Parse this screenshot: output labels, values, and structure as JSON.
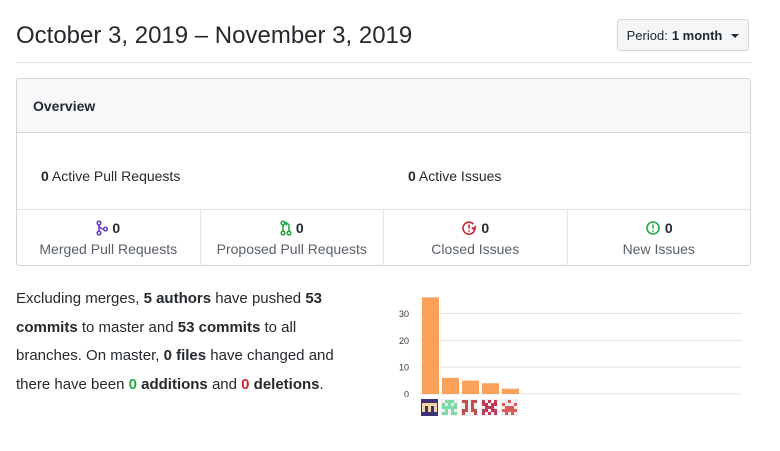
{
  "header": {
    "title": "October 3, 2019 – November 3, 2019",
    "period_label": "Period:",
    "period_value": "1 month"
  },
  "overview": {
    "title": "Overview",
    "active_pull_requests": {
      "count": "0",
      "label": "Active Pull Requests"
    },
    "active_issues": {
      "count": "0",
      "label": "Active Issues"
    },
    "stats": [
      {
        "count": "0",
        "label": "Merged Pull Requests",
        "icon": "git-merge-icon",
        "color": "#6f42c1"
      },
      {
        "count": "0",
        "label": "Proposed Pull Requests",
        "icon": "git-pull-request-icon",
        "color": "#28a745"
      },
      {
        "count": "0",
        "label": "Closed Issues",
        "icon": "issue-closed-icon",
        "color": "#cb2431"
      },
      {
        "count": "0",
        "label": "New Issues",
        "icon": "issue-opened-icon",
        "color": "#28a745"
      }
    ]
  },
  "description": {
    "t1": "Excluding merges, ",
    "authors": "5 authors",
    "t2": " have pushed ",
    "commits_master": "53 commits",
    "t3": " to master and ",
    "commits_all": "53 commits",
    "t4": " to all branches. On master, ",
    "files": "0 files",
    "t5": " have changed and there have been ",
    "additions_num": "0",
    "additions_word": "additions",
    "t6": " and ",
    "deletions_num": "0",
    "deletions_word": "deletions",
    "t7": "."
  },
  "chart_data": {
    "type": "bar",
    "categories": [
      "author 1",
      "author 2",
      "author 3",
      "author 4",
      "author 5"
    ],
    "values": [
      36,
      6,
      5,
      4,
      2
    ],
    "ylim": [
      0,
      38
    ],
    "yticks": [
      0,
      10,
      20,
      30
    ],
    "bar_color": "#f9a05a",
    "grid": true
  },
  "avatars": [
    {
      "icon": "avatar-identicon-1",
      "color": "#40307a"
    },
    {
      "icon": "avatar-identicon-2",
      "color": "#7fd9a8"
    },
    {
      "icon": "avatar-identicon-3",
      "color": "#c0504d"
    },
    {
      "icon": "avatar-identicon-4",
      "color": "#c23a5a"
    },
    {
      "icon": "avatar-identicon-5",
      "color": "#d95a5a"
    }
  ]
}
